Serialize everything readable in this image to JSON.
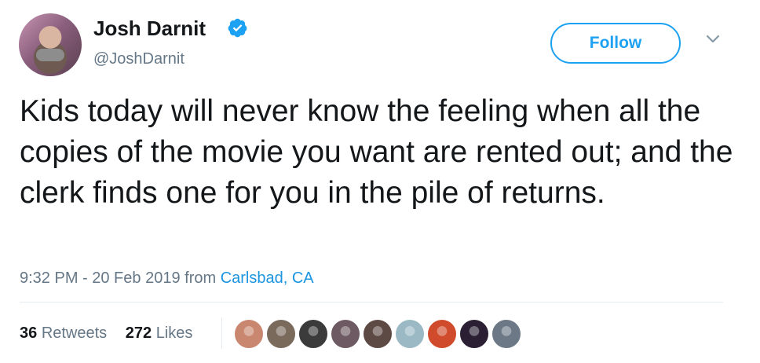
{
  "user": {
    "name": "Josh Darnit",
    "handle": "@JoshDarnit",
    "verified": true,
    "avatar_icon": "profile-photo"
  },
  "actions": {
    "follow_label": "Follow",
    "menu_icon": "chevron-down-icon"
  },
  "tweet": {
    "text": "Kids today will never know the feeling when all the copies of the movie you want are rented out; and the clerk finds one for you in the pile of returns."
  },
  "meta": {
    "time": "9:32 PM - 20 Feb 2019",
    "from_label": "from",
    "location": "Carlsbad, CA"
  },
  "stats": {
    "retweets_count": "36",
    "retweets_label": "Retweets",
    "likes_count": "272",
    "likes_label": "Likes"
  },
  "likers": [
    {
      "name": "liker-avatar-1",
      "color": "#c9876f"
    },
    {
      "name": "liker-avatar-2",
      "color": "#7a6a5c"
    },
    {
      "name": "liker-avatar-3",
      "color": "#3b3b3b"
    },
    {
      "name": "liker-avatar-4",
      "color": "#6d5a63"
    },
    {
      "name": "liker-avatar-5",
      "color": "#5e4a45"
    },
    {
      "name": "liker-avatar-6",
      "color": "#9ab9c4"
    },
    {
      "name": "liker-avatar-7",
      "color": "#d04b2b"
    },
    {
      "name": "liker-avatar-8",
      "color": "#2a1f33"
    },
    {
      "name": "liker-avatar-9",
      "color": "#6c7885"
    }
  ],
  "colors": {
    "accent": "#1da1f2",
    "link": "#1b95e0",
    "muted": "#657786",
    "text": "#14171a"
  }
}
